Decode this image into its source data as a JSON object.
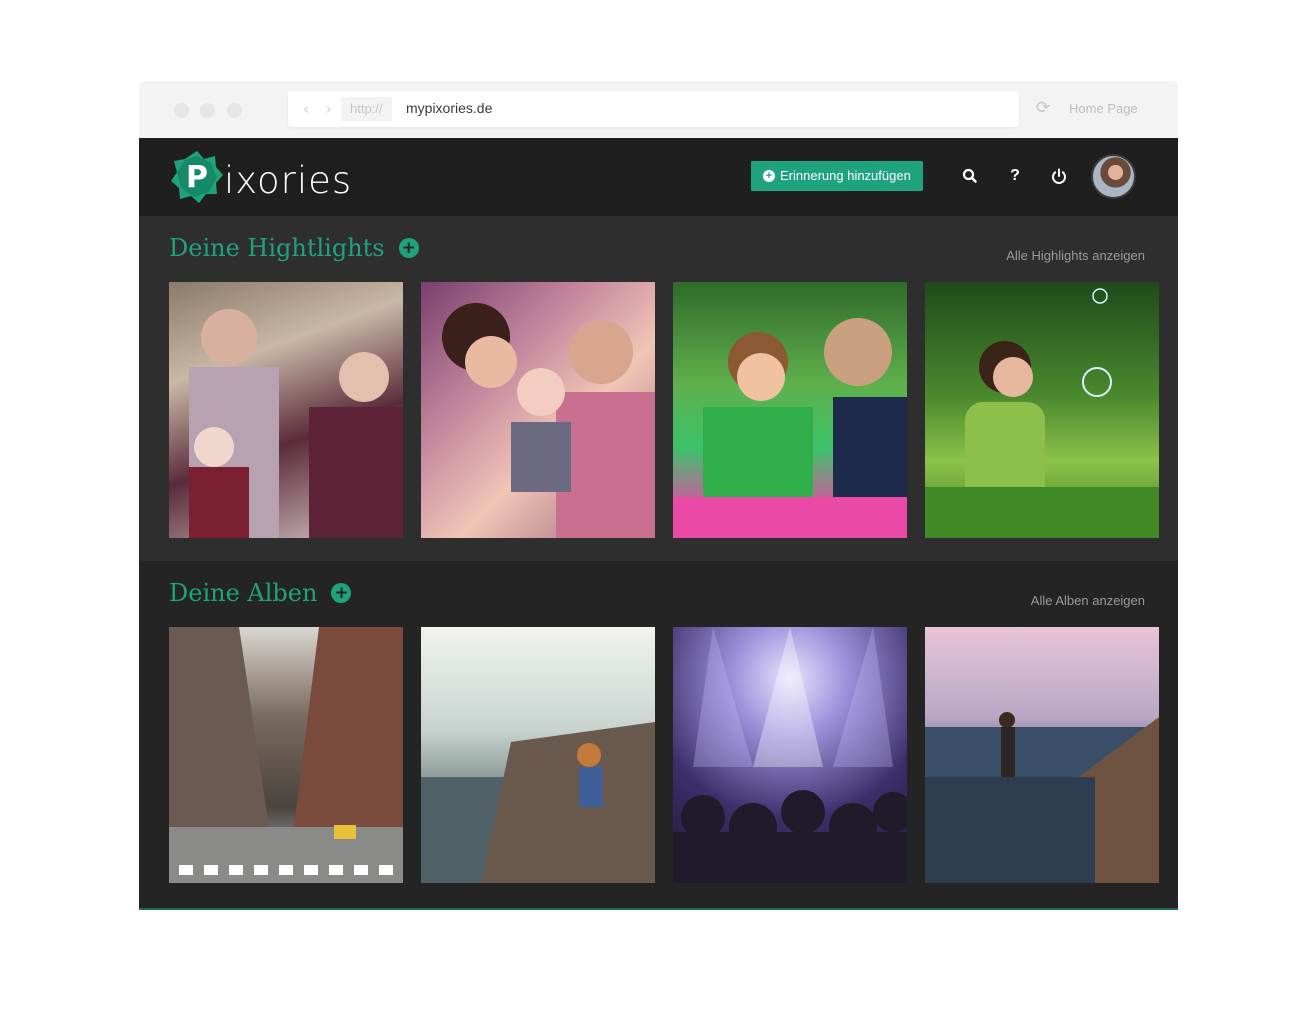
{
  "browser": {
    "protocol": "http://",
    "url": "mypixories.de",
    "home_label": "Home Page",
    "nav_arrows": "‹ ›",
    "reload_icon": "reload-icon"
  },
  "header": {
    "logo_letter": "P",
    "logo_text": "ixories",
    "add_button_label": "Erinnerung hinzufügen",
    "icons": [
      "search-icon",
      "help-icon",
      "power-icon"
    ],
    "help_glyph": "?",
    "accent_color": "#1fa37c"
  },
  "highlights": {
    "title": "Deine Hightlights",
    "link": "Alle Highlights anzeigen",
    "photos": [
      "grandparents-with-baby",
      "parents-kissing-baby",
      "two-boys-playing",
      "girl-with-bubbles"
    ]
  },
  "albums": {
    "title": "Deine Alben",
    "link": "Alle Alben anzeigen",
    "photos": [
      "city-street",
      "woman-on-rocks-by-sea",
      "concert-crowd",
      "man-at-beach-sunset"
    ]
  }
}
